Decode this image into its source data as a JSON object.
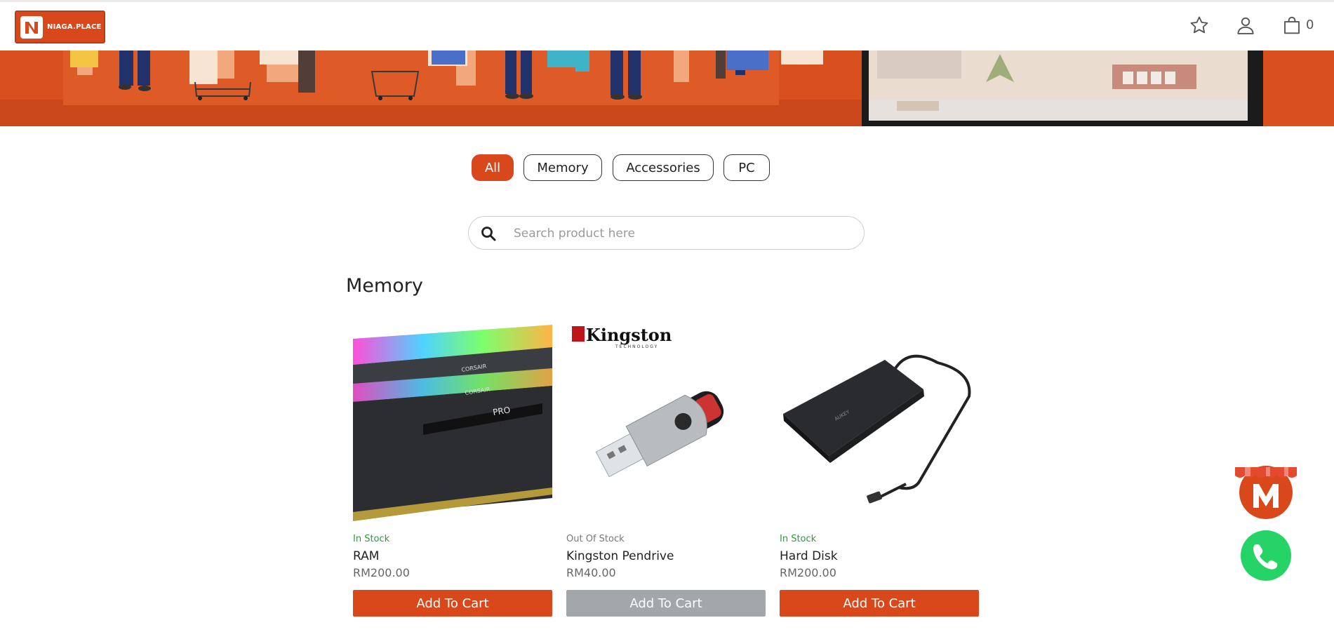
{
  "brand": {
    "logo_text": "NIAGA.PLACE"
  },
  "header": {
    "wishlist_icon": "star-icon",
    "account_icon": "user-icon",
    "cart_icon": "shopping-bag-icon",
    "cart_count": "0"
  },
  "categories": {
    "items": [
      "All",
      "Memory",
      "Accessories",
      "PC"
    ],
    "active": "All"
  },
  "search": {
    "placeholder": "Search product here"
  },
  "section": {
    "title": "Memory"
  },
  "products": [
    {
      "stock": "In Stock",
      "name": "RAM",
      "price": "RM200.00",
      "button": "Add To Cart",
      "available": true
    },
    {
      "stock": "Out Of Stock",
      "name": "Kingston Pendrive",
      "price": "RM40.00",
      "button": "Add To Cart",
      "available": false
    },
    {
      "stock": "In Stock",
      "name": "Hard Disk",
      "price": "RM200.00",
      "button": "Add To Cart",
      "available": true
    }
  ],
  "colors": {
    "accent": "#d9481b",
    "in_stock": "#2c9a3e",
    "disabled": "#a3a6ab",
    "whatsapp": "#25d366"
  }
}
